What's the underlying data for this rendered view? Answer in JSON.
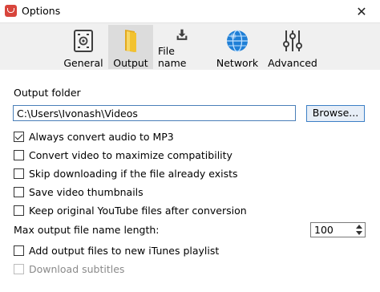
{
  "window": {
    "title": "Options",
    "close_glyph": "✕"
  },
  "tabs": [
    {
      "label": "General",
      "icon": "settings-box-icon",
      "active": false
    },
    {
      "label": "Output",
      "icon": "folder-icon",
      "active": true
    },
    {
      "label": "File name",
      "icon": "download-tray-icon",
      "active": false
    },
    {
      "label": "Network",
      "icon": "globe-icon",
      "active": false
    },
    {
      "label": "Advanced",
      "icon": "sliders-icon",
      "active": false
    }
  ],
  "output": {
    "folder_label": "Output folder",
    "folder_value": "C:\\Users\\Ivonash\\Videos",
    "browse_label": "Browse...",
    "options": [
      {
        "label": "Always convert audio to MP3",
        "checked": true,
        "enabled": true
      },
      {
        "label": "Convert video to maximize compatibility",
        "checked": false,
        "enabled": true
      },
      {
        "label": "Skip downloading if the file already exists",
        "checked": false,
        "enabled": true
      },
      {
        "label": "Save video thumbnails",
        "checked": false,
        "enabled": true
      },
      {
        "label": "Keep original YouTube files after conversion",
        "checked": false,
        "enabled": true
      }
    ],
    "max_length_label": "Max output file name length:",
    "max_length_value": "100",
    "itunes_label": "Add output files to new iTunes playlist",
    "itunes_checked": false,
    "subtitles_label": "Download subtitles",
    "subtitles_enabled": false
  },
  "colors": {
    "accent": "#3c7fc6",
    "folder_yellow": "#f2c230",
    "globe_blue": "#1f7fd6",
    "icon_dark": "#3f3f3f",
    "app_icon": "#d8453c"
  }
}
